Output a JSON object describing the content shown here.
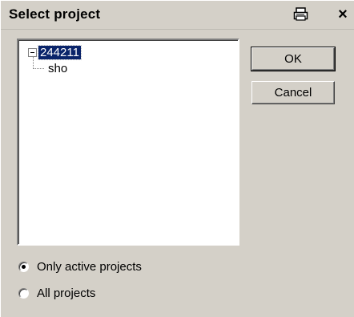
{
  "window": {
    "title": "Select project",
    "close_glyph": "×"
  },
  "tree": {
    "root_label": "244211",
    "child_label": "sho"
  },
  "buttons": {
    "ok_label": "OK",
    "cancel_label": "Cancel"
  },
  "filter": {
    "options": [
      "Only active projects",
      "All projects"
    ],
    "selected": "Only active projects"
  },
  "icons": {
    "print": "printer-icon",
    "close": "close-icon",
    "collapse": "minus-expander-icon"
  },
  "colors": {
    "selection_bg": "#0a246a",
    "dialog_bg": "#d4d0c8"
  }
}
